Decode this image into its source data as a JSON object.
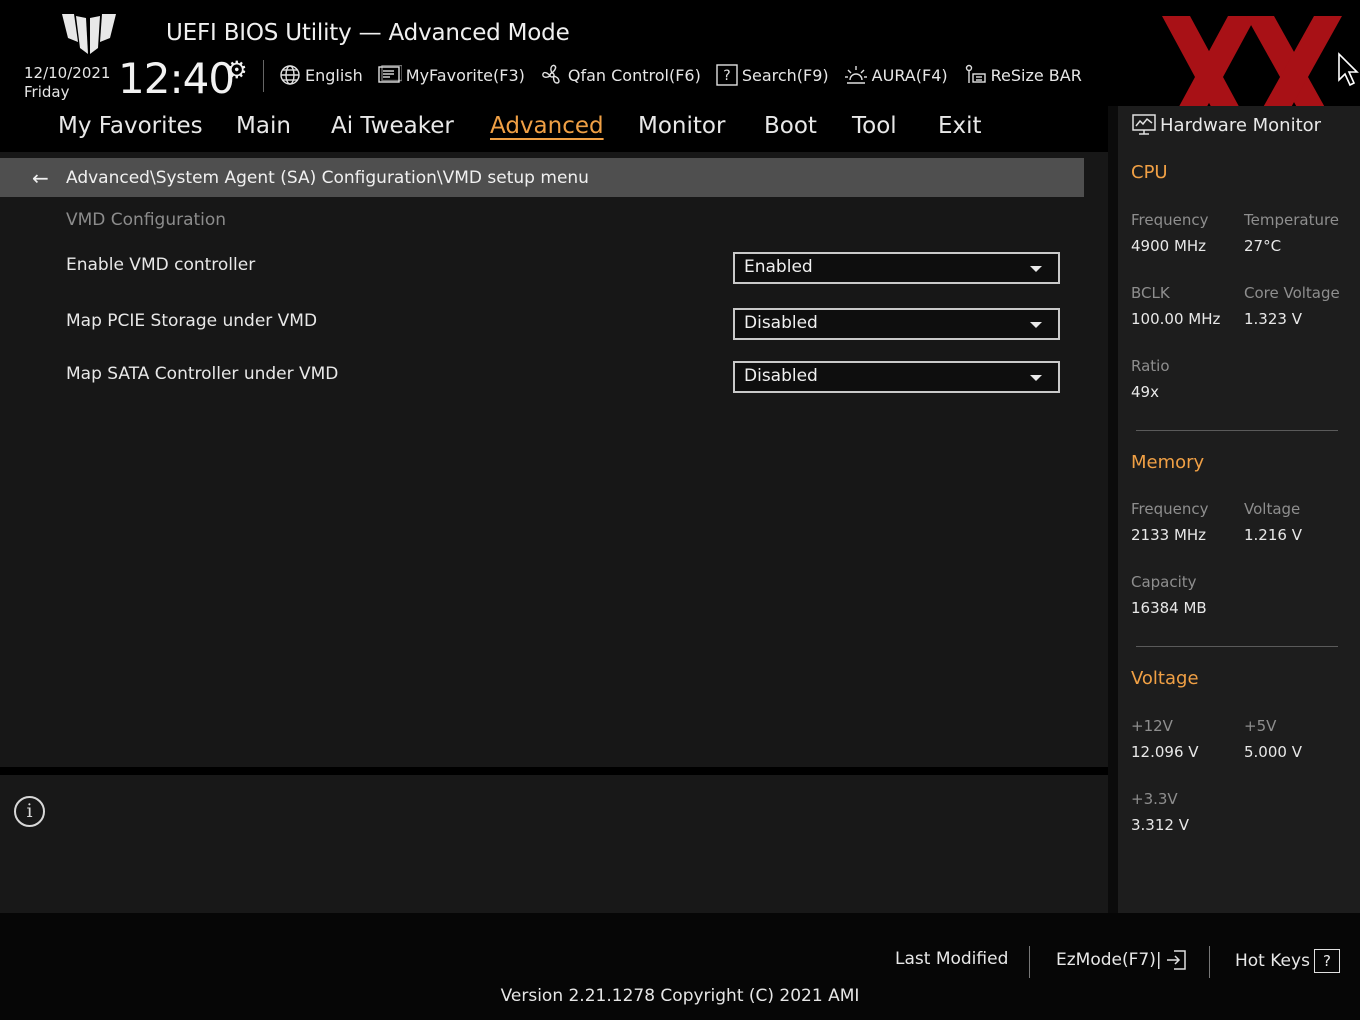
{
  "app": {
    "title": "UEFI BIOS Utility — Advanced Mode",
    "date": "12/10/2021",
    "day": "Friday",
    "time": "12:40"
  },
  "toolbar": [
    {
      "label": "English",
      "icon": "globe-icon"
    },
    {
      "label": "MyFavorite(F3)",
      "icon": "favorite-icon"
    },
    {
      "label": "Qfan Control(F6)",
      "icon": "fan-icon"
    },
    {
      "label": "Search(F9)",
      "icon": "search-help-icon"
    },
    {
      "label": "AURA(F4)",
      "icon": "aura-light-icon"
    },
    {
      "label": "ReSize BAR",
      "icon": "resize-bar-icon"
    }
  ],
  "tabs": [
    {
      "label": "My Favorites"
    },
    {
      "label": "Main"
    },
    {
      "label": "Ai Tweaker"
    },
    {
      "label": "Advanced",
      "active": true
    },
    {
      "label": "Monitor"
    },
    {
      "label": "Boot"
    },
    {
      "label": "Tool"
    },
    {
      "label": "Exit"
    }
  ],
  "breadcrumb": "Advanced\\System Agent (SA) Configuration\\VMD setup menu",
  "section_title": "VMD Configuration",
  "options": [
    {
      "label": "Enable VMD controller",
      "value": "Enabled"
    },
    {
      "label": "Map PCIE Storage under VMD",
      "value": "Disabled"
    },
    {
      "label": "Map SATA Controller under VMD",
      "value": "Disabled"
    }
  ],
  "hw_monitor": {
    "title": "Hardware Monitor",
    "cpu": {
      "title": "CPU",
      "frequency_label": "Frequency",
      "frequency": "4900 MHz",
      "temperature_label": "Temperature",
      "temperature": "27°C",
      "bclk_label": "BCLK",
      "bclk": "100.00 MHz",
      "core_voltage_label": "Core Voltage",
      "core_voltage": "1.323 V",
      "ratio_label": "Ratio",
      "ratio": "49x"
    },
    "memory": {
      "title": "Memory",
      "frequency_label": "Frequency",
      "frequency": "2133 MHz",
      "voltage_label": "Voltage",
      "voltage": "1.216 V",
      "capacity_label": "Capacity",
      "capacity": "16384 MB"
    },
    "voltage": {
      "title": "Voltage",
      "v12_label": "+12V",
      "v12": "12.096 V",
      "v5_label": "+5V",
      "v5": "5.000 V",
      "v33_label": "+3.3V",
      "v33": "3.312 V"
    }
  },
  "footer": {
    "last_modified": "Last Modified",
    "ezmode": "EzMode(F7)|",
    "hotkeys": "Hot Keys",
    "hotkeys_key": "?",
    "version": "Version 2.21.1278 Copyright (C) 2021 AMI"
  },
  "colors": {
    "accent": "#f0a045",
    "watermark": "#c0141a"
  }
}
